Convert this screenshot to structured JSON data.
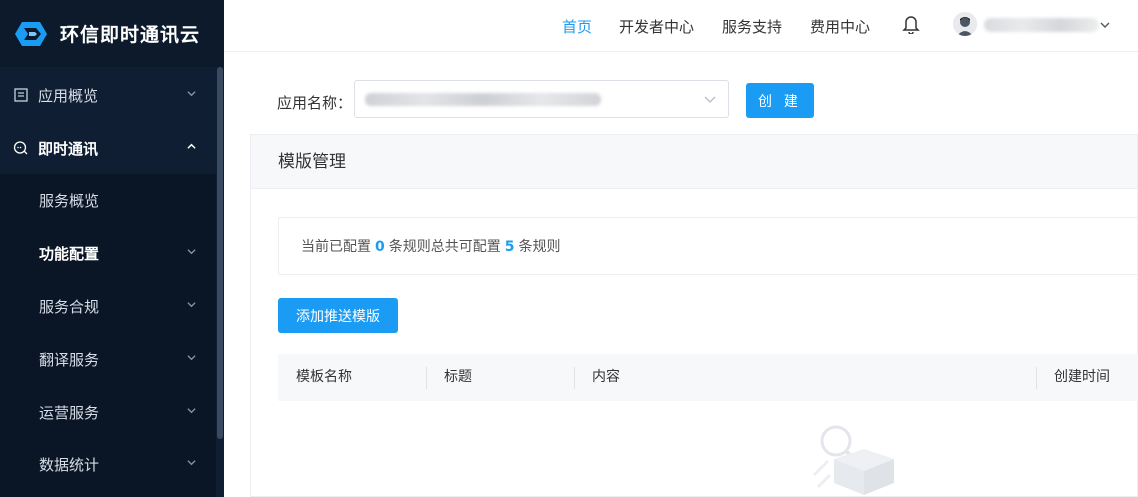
{
  "brand": {
    "title": "环信即时通讯云"
  },
  "sidebar": {
    "items": [
      {
        "label": "应用概览",
        "icon": "document-list-icon"
      },
      {
        "label": "即时通讯",
        "icon": "chat-bubble-icon"
      },
      {
        "label": "服务概览"
      },
      {
        "label": "功能配置"
      },
      {
        "label": "服务合规"
      },
      {
        "label": "翻译服务"
      },
      {
        "label": "运营服务"
      },
      {
        "label": "数据统计"
      }
    ]
  },
  "topnav": {
    "links": [
      "首页",
      "开发者中心",
      "服务支持",
      "费用中心"
    ]
  },
  "form": {
    "app_label": "应用名称：",
    "create_label": "创 建"
  },
  "panel": {
    "title": "模版管理",
    "rule_text_1": "当前已配置",
    "configured_count": "0",
    "rule_text_2": "条规则总共可配置",
    "total_count": "5",
    "rule_text_3": "条规则",
    "add_button": "添加推送模版",
    "columns": [
      "模板名称",
      "标题",
      "内容",
      "创建时间"
    ]
  },
  "colors": {
    "accent": "#1a9cf5",
    "sidebar_bg": "#0f1e33"
  }
}
